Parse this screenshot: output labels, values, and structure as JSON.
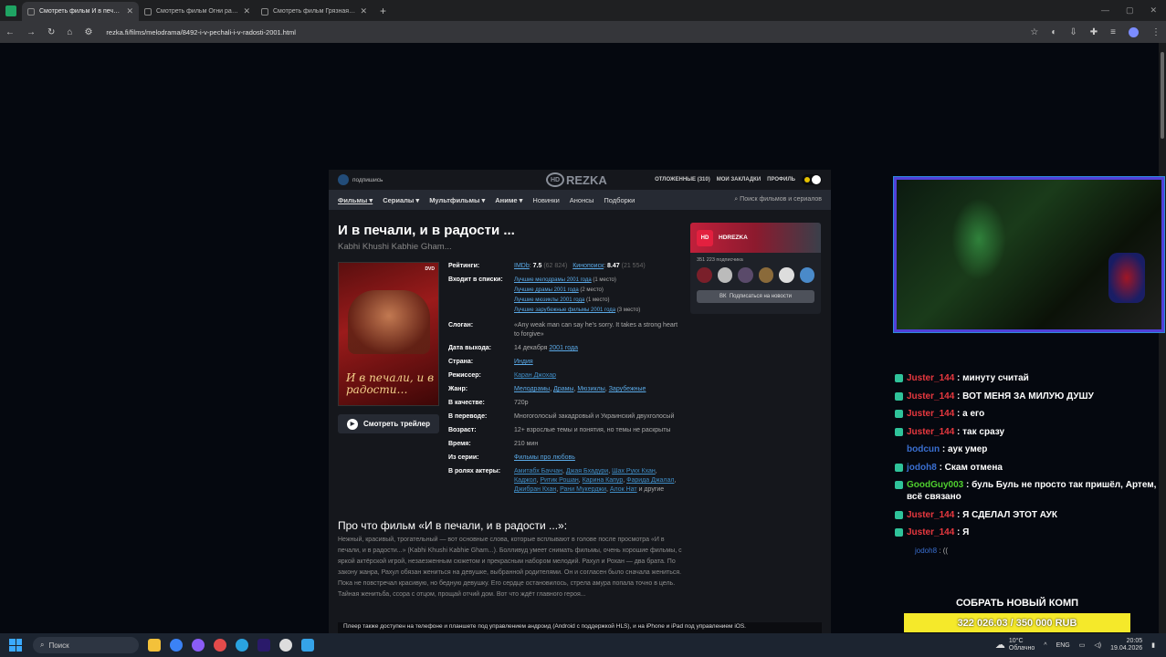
{
  "browser": {
    "tabs": [
      {
        "title": "Смотреть фильм И в печали, и",
        "active": true
      },
      {
        "title": "Смотреть фильм Огни рампы",
        "active": false
      },
      {
        "title": "Смотреть фильм Грязная доз",
        "active": false
      }
    ],
    "url": "rezka.fi/films/melodrama/8492-i-v-pechali-i-v-radosti-2001.html"
  },
  "site": {
    "subscribe": "подпишись",
    "logo": "REZKA",
    "logo_hd": "HD",
    "header_links": {
      "deferred": "ОТЛОЖЕННЫЕ",
      "deferred_count": "(310)",
      "bookmarks": "МОИ ЗАКЛАДКИ",
      "profile": "ПРОФИЛЬ"
    },
    "nav": [
      "Фильмы",
      "Сериалы",
      "Мультфильмы",
      "Аниме",
      "Новинки",
      "Анонсы",
      "Подборки"
    ],
    "search_placeholder": "Поиск фильмов и сериалов"
  },
  "movie": {
    "title": "И в печали, и в радости ...",
    "original": "Kabhi Khushi Kabhie Gham...",
    "poster_title": "И в печали, и в радости…",
    "poster_label": "DVD",
    "trailer": "Смотреть трейлер",
    "ratings_label": "Рейтинги:",
    "imdb_label": "IMDb",
    "imdb_rating": "7.5",
    "imdb_votes": "(62 824)",
    "kp_label": "Кинопоиск",
    "kp_rating": "8.47",
    "kp_votes": "(21 554)",
    "lists_label": "Входит в списки:",
    "lists": [
      {
        "link": "Лучшие мелодрамы 2001 года",
        "place": "(1 место)"
      },
      {
        "link": "Лучшие драмы 2001 года",
        "place": "(2 место)"
      },
      {
        "link": "Лучшие мюзиклы 2001 года",
        "place": "(1 место)"
      },
      {
        "link": "Лучшие зарубежные фильмы 2001 года",
        "place": "(3 место)"
      }
    ],
    "slogan_label": "Слоган:",
    "slogan": "«Any weak man can say he's sorry. It takes a strong heart to forgive»",
    "release_label": "Дата выхода:",
    "release_date": "14 декабря",
    "release_year": "2001 года",
    "country_label": "Страна:",
    "country": "Индия",
    "director_label": "Режиссер:",
    "director": "Каран Джохар",
    "genre_label": "Жанр:",
    "genres": [
      "Мелодрамы",
      "Драмы",
      "Мюзиклы",
      "Зарубежные"
    ],
    "quality_label": "В качестве:",
    "quality": "720p",
    "translation_label": "В переводе:",
    "translation": "Многоголосый закадровый и Украинский двухголосый",
    "age_label": "Возраст:",
    "age": "12+ взрослые темы и понятия, но темы не раскрыты",
    "time_label": "Время:",
    "time": "210 мин",
    "series_label": "Из серии:",
    "series": "Фильмы про любовь",
    "cast_label": "В ролях актеры:",
    "cast": [
      "Амитабх Баччан",
      "Джая Бхадури",
      "Шах Рукх Кхан",
      "Каджол",
      "Ритик Рошан",
      "Карина Капур",
      "Фарида Джалал",
      "Джибран Кхан",
      "Рани Мукерджи",
      "Алок Нат"
    ],
    "cast_more": "и другие",
    "about_heading": "Про что фильм «И в печали, и в радости ...»:",
    "about": "Нежный, красивый, трогательный — вот основные слова, которые всплывают в голове после просмотра «И в печали, и в радости...» (Kabhi Khushi Kabhie Gham...). Болливуд умеет снимать фильмы, очень хорошие фильмы, с яркой актёрской игрой, незаезженным сюжетом и прекрасным набором мелодий. Рахул и Рохан — два брата. По закону жанра, Рахул обязан жениться на девушке, выбранной родителями. Он и согласен было сначала жениться. Пока не повстречал красивую, но бедную девушку. Его сердце остановилось, стрела амура попала точно в цель. Тайная женитьба, ссора с отцом, прощай отчий дом. Вот что ждёт главного героя...",
    "footer_note": "Плеер также доступен на телефоне и планшете под управлением андроид (Android с поддержкой HLS), и на iPhone и iPad под управлением iOS."
  },
  "widget": {
    "channel": "HDREZKA",
    "subscribers": "351 223 подписчика",
    "button": "Подписаться на новости",
    "vk": "ВК"
  },
  "chat": [
    {
      "user": "Juster_144",
      "text": ": минуту считай",
      "color": "red"
    },
    {
      "user": "Juster_144",
      "text": ": ВОТ МЕНЯ ЗА МИЛУЮ ДУШУ",
      "color": "red"
    },
    {
      "user": "Juster_144",
      "text": ": а его",
      "color": "red"
    },
    {
      "user": "Juster_144",
      "text": ": так сразу",
      "color": "red"
    },
    {
      "user": "bodcun",
      "text": ": аук умер",
      "color": "blue"
    },
    {
      "user": "jodoh8",
      "text": ": Скам отмена",
      "color": "blue"
    },
    {
      "user": "GoodGuy003",
      "text": ": буль Буль не просто так пришёл, Артем, всё связано",
      "color": "green"
    },
    {
      "user": "Juster_144",
      "text": ": Я СДЕЛАЛ ЭТОТ АУК",
      "color": "red"
    },
    {
      "user": "Juster_144",
      "text": ": Я",
      "color": "red"
    }
  ],
  "chat_small": {
    "user": "jodoh8",
    "text": ": (("
  },
  "goal": {
    "title": "СОБРАТЬ НОВЫЙ КОМП",
    "value": "322 026.03 / 350 000 RUB",
    "progress": 0.92
  },
  "taskbar": {
    "search": "Поиск",
    "temp": "10°C",
    "weather": "Облачно",
    "lang": "ENG",
    "time": "20:05",
    "date": "19.04.2026"
  },
  "colors": {
    "accent": "#5aa9e6",
    "chat_red": "#e8383f",
    "goal": "#f5e92a"
  }
}
